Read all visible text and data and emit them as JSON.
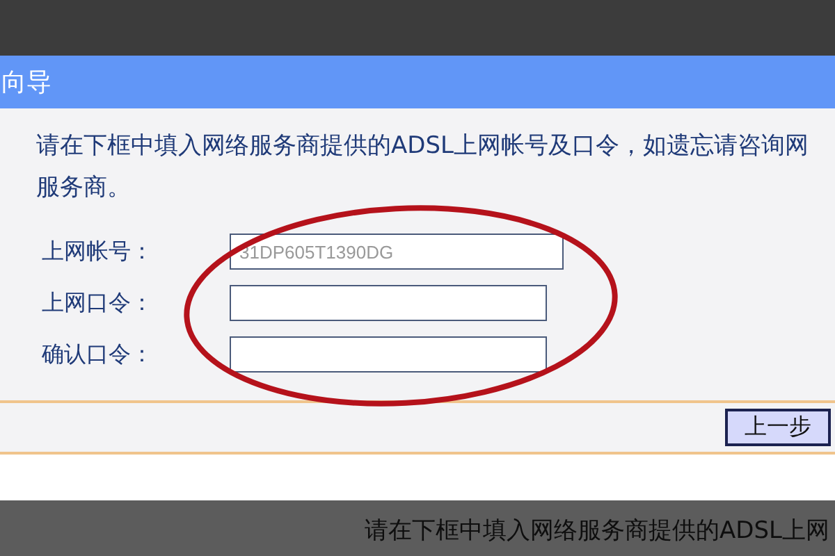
{
  "window": {
    "title": "向导"
  },
  "instructions": "请在下框中填入网络服务商提供的ADSL上网帐号及口令，如遗忘请咨询网",
  "instructions_continued": "服务商。",
  "fields": [
    {
      "label": "上网帐号：",
      "value": "31DP605T1390DG"
    },
    {
      "label": "上网口令："
    },
    {
      "label": "确认口令："
    }
  ],
  "buttons": [
    "上一步"
  ],
  "background_text": "请在下框中填入网络服务商提供的ADSL上网"
}
